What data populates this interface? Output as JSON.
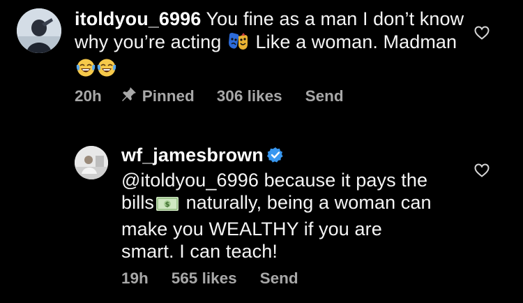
{
  "comments": [
    {
      "username": "itoldyou_6996",
      "text_part1": "You fine as a man I don’t know why you’re acting",
      "emoji1": "performing-arts-icon",
      "text_part2": "Like a woman.  Madman",
      "emoji2": "tears-of-joy-icon",
      "time": "20h",
      "pinned_label": "Pinned",
      "likes": "306 likes",
      "send_label": "Send"
    },
    {
      "username": "wf_jamesbrown",
      "verified": true,
      "mention": "@itoldyou_6996",
      "text_part1": "because it pays the bills",
      "emoji1": "dollar-banknote-icon",
      "text_part2": "naturally, being a woman can make you WEALTHY if you are smart. I can teach!",
      "time": "19h",
      "likes": "565 likes",
      "send_label": "Send"
    }
  ],
  "colors": {
    "background": "#000000",
    "text": "#f5f5f5",
    "meta": "#a8a8a8",
    "verified": "#3897f0"
  }
}
